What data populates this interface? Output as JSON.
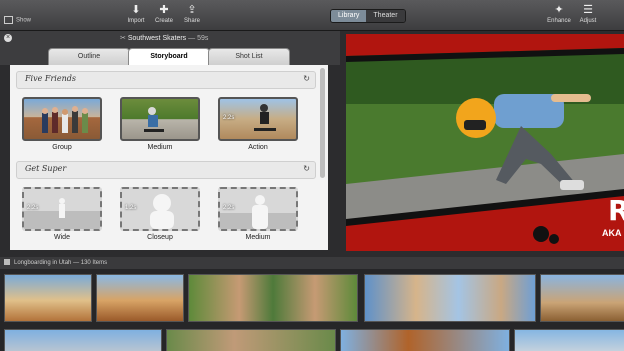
{
  "toolbar": {
    "show_label": "Show",
    "import_label": "Import",
    "create_label": "Create",
    "share_label": "Share",
    "library_label": "Library",
    "theater_label": "Theater",
    "enhance_label": "Enhance",
    "adjust_label": "Adjust"
  },
  "project": {
    "title": "Southwest Skaters",
    "duration": "— 59s"
  },
  "tabs": [
    {
      "label": "Outline"
    },
    {
      "label": "Storyboard"
    },
    {
      "label": "Shot List"
    }
  ],
  "storyboard": {
    "sections": [
      {
        "name": "Five Friends",
        "clips": [
          {
            "label": "Group",
            "duration": ""
          },
          {
            "label": "Medium",
            "duration": ""
          },
          {
            "label": "Action",
            "duration": "2.2s"
          }
        ]
      },
      {
        "name": "Get Super",
        "clips": [
          {
            "label": "Wide",
            "duration": "2.2s"
          },
          {
            "label": "Closeup",
            "duration": "1.2s"
          },
          {
            "label": "Medium",
            "duration": "2.2s"
          }
        ]
      }
    ]
  },
  "viewer": {
    "overlay_letter": "R",
    "overlay_text": "AKA"
  },
  "event": {
    "title": "Longboarding in Utah",
    "count": "— 130 Items"
  },
  "colors": {
    "accent": "#7d8c99",
    "banner_red": "#b1150f"
  }
}
